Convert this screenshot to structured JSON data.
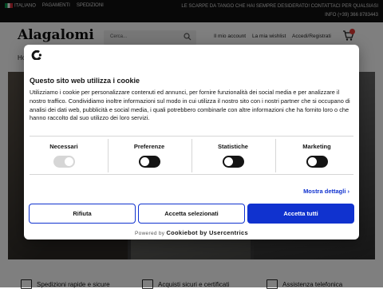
{
  "topbar": {
    "language": "ITALIANO",
    "links": [
      "PAGAMENTI",
      "SPEDIZIONI"
    ],
    "promo": "LE SCARPE DA TANGO CHE HAI SEMPRE DESIDERATO! CONTATTACI PER QUALSIASI",
    "info": "INFO   (+39) 366 8783443"
  },
  "header": {
    "logo": "Alagalomi",
    "search_placeholder": "Cerca...",
    "nav": [
      "Il mio account",
      "La mia wishlist",
      "Accedi/Registrati"
    ],
    "cart_badge": "0"
  },
  "breadcrumb": "Ho",
  "features": [
    "Spedizioni rapide e sicure",
    "Acquisti sicuri e certificati",
    "Assistenza telefonica"
  ],
  "cookie": {
    "title": "Questo sito web utilizza i cookie",
    "text": "Utilizziamo i cookie per personalizzare contenuti ed annunci, per fornire funzionalità dei social media e per analizzare il nostro traffico. Condividiamo inoltre informazioni sul modo in cui utilizza il nostro sito con i nostri partner che si occupano di analisi dei dati web, pubblicità e social media, i quali potrebbero combinarle con altre informazioni che ha fornito loro o che hanno raccolto dal suo utilizzo dei loro servizi.",
    "categories": [
      "Necessari",
      "Preferenze",
      "Statistiche",
      "Marketing"
    ],
    "details": "Mostra dettagli",
    "buttons": {
      "deny": "Rifiuta",
      "selected": "Accetta selezionati",
      "all": "Accetta tutti"
    },
    "powered_prefix": "Powered by ",
    "powered_brand": "Cookiebot by Usercentrics"
  }
}
